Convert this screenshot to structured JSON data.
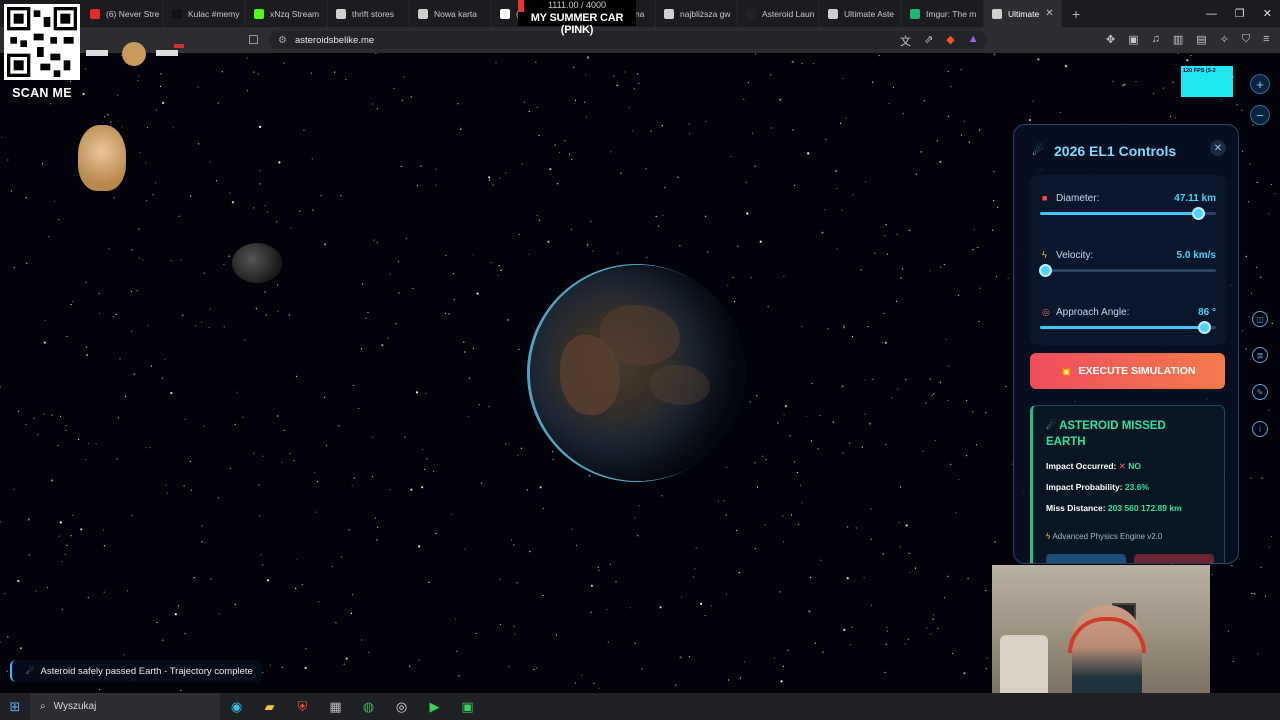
{
  "browser": {
    "tabs": [
      {
        "label": "(6) Never Stre",
        "color": "#e62b2b"
      },
      {
        "label": "Kulac #memy",
        "color": "#111111"
      },
      {
        "label": "xNzq Stream",
        "color": "#53fc18"
      },
      {
        "label": "thrift stores",
        "color": "#cfcfcf"
      },
      {
        "label": "Nowa karta",
        "color": "#cfcfcf"
      },
      {
        "label": "(2)",
        "color": "#ffffff"
      },
      {
        "label": "(20) Główna",
        "color": "#cfcfcf"
      },
      {
        "label": "najbliższa gw",
        "color": "#cfcfcf"
      },
      {
        "label": "Asteroid Laun",
        "color": "#222222"
      },
      {
        "label": "Ultimate Aste",
        "color": "#cfcfcf"
      },
      {
        "label": "Imgur: The m",
        "color": "#1bb76e"
      },
      {
        "label": "Ultimate",
        "color": "#cfcfcf",
        "active": true
      }
    ],
    "new_tab": "+",
    "url": "asteroidsbelike.me"
  },
  "stream_overlay": {
    "song_counter": "1111.00 / 4000",
    "song_title": "MY SUMMER CAR (PINK)",
    "qr_caption": "SCAN ME",
    "fps_label": "120 FPS (5-2"
  },
  "panel": {
    "title": "2026 EL1 Controls",
    "title_icon": "comet-icon",
    "params": [
      {
        "label": "Diameter:",
        "value": "47.11 km",
        "icon": "red-square",
        "level": 0.9
      },
      {
        "label": "Velocity:",
        "value": "5.0 km/s",
        "icon": "lightning",
        "level": 0.03
      },
      {
        "label": "Approach Angle:",
        "value": "86 °",
        "icon": "target",
        "level": 0.93
      }
    ],
    "execute_label": "EXECUTE SIMULATION",
    "result": {
      "title": "ASTEROID MISSED EARTH",
      "impact_occurred_label": "Impact Occurred:",
      "impact_occurred_value": "NO",
      "impact_probability_label": "Impact Probability:",
      "impact_probability_value": "23.6%",
      "miss_distance_label": "Miss Distance:",
      "miss_distance_value": "203 560 172.89 km",
      "engine_label": "Advanced Physics Engine v2.0"
    }
  },
  "toast": "Asteroid safely passed Earth - Trajectory complete",
  "taskbar": {
    "search_placeholder": "Wyszukaj"
  },
  "colors": {
    "accent": "#3fc6ff",
    "success": "#2ee39a",
    "danger": "#f04d5c"
  }
}
